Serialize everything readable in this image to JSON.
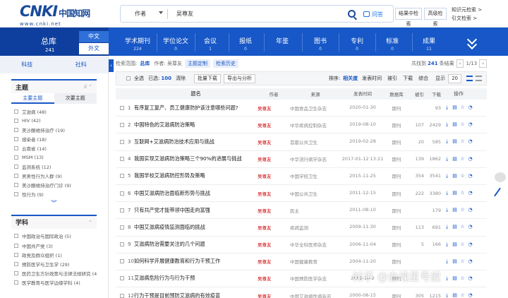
{
  "header": {
    "logo_main": "CNKI",
    "logo_cn": "中国知网",
    "logo_url": "www.cnki.net",
    "search_field": "作者",
    "search_value": "吴尊友",
    "ask_label": "问答",
    "btn_result_search": "结果中检索",
    "btn_advanced": "高级检索",
    "link_knowledge": "知识元检索 >",
    "link_citation": "引文检索 >"
  },
  "nav": {
    "all_label": "总库",
    "all_count": "241",
    "lang_zh": "中文",
    "lang_en": "外文",
    "items": [
      {
        "label": "学术期刊",
        "count": "224"
      },
      {
        "label": "学位论文",
        "count": "0"
      },
      {
        "label": "会议",
        "count": "1"
      },
      {
        "label": "报纸",
        "count": "0"
      },
      {
        "label": "年鉴",
        "count": ""
      },
      {
        "label": "图书",
        "count": "0"
      },
      {
        "label": "专利",
        "count": "0"
      },
      {
        "label": "标准",
        "count": "0"
      },
      {
        "label": "成果",
        "count": "11"
      }
    ]
  },
  "sidebar": {
    "tab_discipline": "科技",
    "tab_social": "社科",
    "topic": {
      "title": "主题",
      "sub_primary": "主要主题",
      "sub_secondary": "次要主题",
      "items": [
        "艾滋病 (48)",
        "HIV (42)",
        "美沙酮维持治疗 (19)",
        "感染者 (18)",
        "云南省 (14)",
        "MSM (13)",
        "监测系统 (12)",
        "男男性行为人群 (9)",
        "美沙酮维持治疗门诊 (9)",
        "性行为 (9)"
      ]
    },
    "subject": {
      "title": "学科",
      "items": [
        "中国政治与国际政治 (5)",
        "中国共产党 (3)",
        "政党及群众组织 (1)",
        "预防医学与卫生学 (29)",
        "医药卫生方针政策与法律法规研究 (49)",
        "医学教育与医学边缘学科 (4)"
      ]
    }
  },
  "toolbar": {
    "scope_label": "检索范围:",
    "scope_value": "总库",
    "scope_query": "作者: 吴尊友",
    "tag_topic": "主题定制",
    "tag_history": "检索历史",
    "found_prefix": "共找到",
    "found_count": "241",
    "found_suffix": "条结果",
    "page_info": "1/13",
    "select_all": "全选",
    "selected_label": "已选:",
    "selected_count": "100",
    "clear": "清除",
    "batch_download": "批量下载",
    "export": "导出与分析",
    "sort_label": "排序:",
    "sort_relevance": "相关度",
    "sort_date": "发表时间",
    "sort_cite": "被引",
    "sort_download": "下载",
    "sort_overall": "综合",
    "display_label": "显示",
    "display_count": "20"
  },
  "table": {
    "headers": {
      "title": "题名",
      "author": "作者",
      "source": "来源",
      "date": "发表时间",
      "db": "数据库",
      "cite": "被引",
      "download": "下载",
      "ops": "操作"
    },
    "rows": [
      {
        "no": "1",
        "title": "有序复工复产、员工健康防护该注意哪些问题?",
        "author": "吴尊友",
        "source": "中国食品卫生杂志",
        "date": "2020-01-30",
        "db": "期刊",
        "cite": "",
        "dl": "93"
      },
      {
        "no": "2",
        "title": "中国特色的艾滋病防治策略",
        "author": "吴尊友",
        "source": "中华疾病控制杂志",
        "date": "2019-08-10",
        "db": "期刊",
        "cite": "107",
        "dl": "2429"
      },
      {
        "no": "3",
        "title": "互联网+艾滋病防治技术应用与挑战",
        "author": "吴尊友",
        "source": "首都公共卫生",
        "date": "2019-02-28",
        "db": "期刊",
        "cite": "20",
        "dl": "585"
      },
      {
        "no": "4",
        "title": "我国实现艾滋病防治策略三个90%的进展与挑战",
        "author": "吴尊友",
        "source": "中华流行病学杂志",
        "date": "2017-01-12 13:21",
        "db": "期刊",
        "cite": "139",
        "dl": "1862"
      },
      {
        "no": "5",
        "title": "我国学校艾滋病防控形势及策略",
        "author": "吴尊友",
        "source": "中国学校卫生",
        "date": "2015-11-25",
        "db": "期刊",
        "cite": "354",
        "dl": "3541"
      },
      {
        "no": "6",
        "title": "中国艾滋病防治面临新形势与挑战",
        "author": "吴尊友",
        "source": "中国公共卫生",
        "date": "2011-12-15",
        "db": "期刊",
        "cite": "222",
        "dl": "3380"
      },
      {
        "no": "7",
        "title": "只有共产党才能带领中国走向富强",
        "author": "吴尊友",
        "source": "民主",
        "date": "2011-08-10",
        "db": "期刊",
        "cite": "",
        "dl": "179"
      },
      {
        "no": "8",
        "title": "中国艾滋病疫情监测面临的挑战",
        "author": "吴尊友",
        "source": "疾病监测",
        "date": "2009-11-30",
        "db": "期刊",
        "cite": "113",
        "dl": "691"
      },
      {
        "no": "9",
        "title": "艾滋病防治需要关注的几个问题",
        "author": "吴尊友",
        "source": "中华全科医师杂志",
        "date": "2006-11-04",
        "db": "期刊",
        "cite": "5",
        "dl": "166"
      },
      {
        "no": "10",
        "title": "如何科学开展健康教育和行为干预工作",
        "author": "吴尊友",
        "source": "中国健康教育",
        "date": "2004-11-20",
        "db": "期刊",
        "cite": "",
        "dl": ""
      },
      {
        "no": "11",
        "title": "艾滋病危险行为与行为干预",
        "author": "吴尊友",
        "source": "中国预防医学杂志",
        "date": "2001-10-2",
        "db": "期刊",
        "cite": "",
        "dl": ""
      },
      {
        "no": "12",
        "title": "行为干预是目前预防艾滋病的有效疫苗",
        "author": "吴尊友",
        "source": "中国艾滋病性病杂志",
        "date": "2000-08-15",
        "db": "期刊",
        "cite": "305",
        "dl": "1215"
      }
    ]
  },
  "watermark": "知乎 @血魂星号舰"
}
